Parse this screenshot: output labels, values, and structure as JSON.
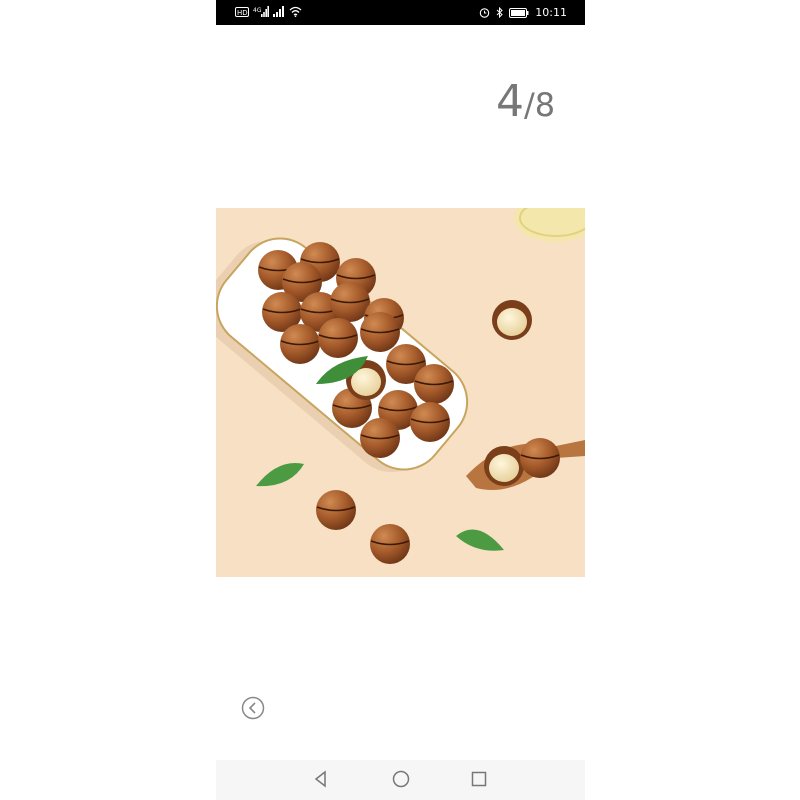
{
  "status_bar": {
    "left_icons": [
      "hd-icon",
      "signal-4g-icon",
      "signal-icon",
      "wifi-icon"
    ],
    "right_icons": [
      "alarm-icon",
      "bluetooth-icon",
      "battery-icon"
    ],
    "time": "10:11"
  },
  "viewer": {
    "current_index": "4",
    "separator": "/",
    "total": "8"
  },
  "image": {
    "subject": "macadamia-nuts-photo"
  },
  "colors": {
    "background": "#ffffff",
    "photo_background": "#f7e0c4",
    "counter_text": "#777777",
    "status_bar": "#000000"
  },
  "nav_bar": {
    "icons": [
      "back-triangle-icon",
      "home-circle-icon",
      "recents-square-icon"
    ]
  }
}
